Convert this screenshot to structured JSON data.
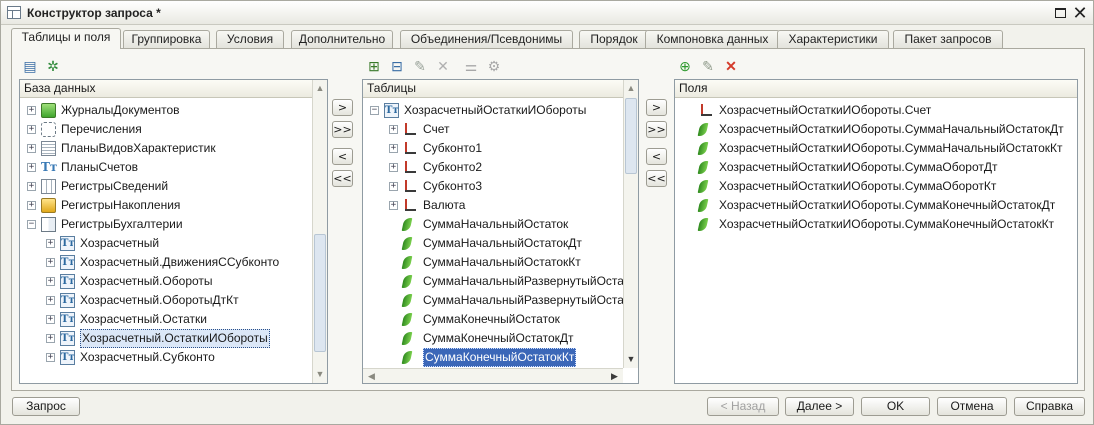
{
  "window": {
    "title": "Конструктор запроса *"
  },
  "tabs": [
    {
      "label": "Таблицы и поля",
      "active": true
    },
    {
      "label": "Группировка"
    },
    {
      "label": "Условия"
    },
    {
      "label": "Дополнительно"
    },
    {
      "label": "Объединения/Псевдонимы"
    },
    {
      "label": "Порядок"
    },
    {
      "label": "Компоновка данных"
    },
    {
      "label": "Характеристики"
    },
    {
      "label": "Пакет запросов"
    }
  ],
  "database_panel": {
    "header": "База данных",
    "items": [
      {
        "label": "ЖурналыДокументов",
        "icon": "journal-icon",
        "expander": "+"
      },
      {
        "label": "Перечисления",
        "icon": "enum-icon",
        "expander": "+"
      },
      {
        "label": "ПланыВидовХарактеристик",
        "icon": "chart-of-char-types-icon",
        "expander": "+"
      },
      {
        "label": "ПланыСчетов",
        "icon": "chart-of-accounts-icon",
        "expander": "+"
      },
      {
        "label": "РегистрыСведений",
        "icon": "info-register-icon",
        "expander": "+"
      },
      {
        "label": "РегистрыНакопления",
        "icon": "accum-register-icon",
        "expander": "+"
      },
      {
        "label": "РегистрыБухгалтерии",
        "icon": "accounting-register-icon",
        "expander": "−"
      },
      {
        "label": "Хозрасчетный",
        "icon": "table-icon",
        "expander": "+",
        "child": true
      },
      {
        "label": "Хозрасчетный.ДвиженияССубконто",
        "icon": "table-icon",
        "expander": "+",
        "child": true
      },
      {
        "label": "Хозрасчетный.Обороты",
        "icon": "table-icon",
        "expander": "+",
        "child": true
      },
      {
        "label": "Хозрасчетный.ОборотыДтКт",
        "icon": "table-icon",
        "expander": "+",
        "child": true
      },
      {
        "label": "Хозрасчетный.Остатки",
        "icon": "table-icon",
        "expander": "+",
        "child": true
      },
      {
        "label": "Хозрасчетный.ОстаткиИОбороты",
        "icon": "table-icon",
        "expander": "+",
        "child": true,
        "selected": true
      },
      {
        "label": "Хозрасчетный.Субконто",
        "icon": "table-icon",
        "expander": "+",
        "child": true
      }
    ]
  },
  "transfer_buttons": {
    "add": ">",
    "add_all": ">>",
    "remove": "<",
    "remove_all": "<<"
  },
  "tables_panel": {
    "header": "Таблицы",
    "items": [
      {
        "label": "ХозрасчетныйОстаткиИОбороты",
        "icon": "table-icon",
        "expander": "−",
        "level": 0
      },
      {
        "label": "Счет",
        "icon": "dimension-icon",
        "expander": "+",
        "level": 1
      },
      {
        "label": "Субконто1",
        "icon": "dimension-icon",
        "expander": "+",
        "level": 1
      },
      {
        "label": "Субконто2",
        "icon": "dimension-icon",
        "expander": "+",
        "level": 1
      },
      {
        "label": "Субконто3",
        "icon": "dimension-icon",
        "expander": "+",
        "level": 1
      },
      {
        "label": "Валюта",
        "icon": "dimension-icon",
        "expander": "+",
        "level": 1
      },
      {
        "label": "СуммаНачальныйОстаток",
        "icon": "resource-icon",
        "level": 1
      },
      {
        "label": "СуммаНачальныйОстатокДт",
        "icon": "resource-icon",
        "level": 1
      },
      {
        "label": "СуммаНачальныйОстатокКт",
        "icon": "resource-icon",
        "level": 1
      },
      {
        "label": "СуммаНачальныйРазвернутыйОстаток",
        "icon": "resource-icon",
        "level": 1
      },
      {
        "label": "СуммаНачальныйРазвернутыйОстаток",
        "icon": "resource-icon",
        "level": 1
      },
      {
        "label": "СуммаКонечныйОстаток",
        "icon": "resource-icon",
        "level": 1
      },
      {
        "label": "СуммаКонечныйОстатокДт",
        "icon": "resource-icon",
        "level": 1
      },
      {
        "label": "СуммаКонечныйОстатокКт",
        "icon": "resource-icon",
        "level": 1,
        "selected": true
      }
    ]
  },
  "fields_panel": {
    "header": "Поля",
    "items": [
      {
        "label": "ХозрасчетныйОстаткиИОбороты.Счет",
        "icon": "dimension-icon"
      },
      {
        "label": "ХозрасчетныйОстаткиИОбороты.СуммаНачальныйОстатокДт",
        "icon": "resource-icon"
      },
      {
        "label": "ХозрасчетныйОстаткиИОбороты.СуммаНачальныйОстатокКт",
        "icon": "resource-icon"
      },
      {
        "label": "ХозрасчетныйОстаткиИОбороты.СуммаОборотДт",
        "icon": "resource-icon"
      },
      {
        "label": "ХозрасчетныйОстаткиИОбороты.СуммаОборотКт",
        "icon": "resource-icon"
      },
      {
        "label": "ХозрасчетныйОстаткиИОбороты.СуммаКонечныйОстатокДт",
        "icon": "resource-icon"
      },
      {
        "label": "ХозрасчетныйОстаткиИОбороты.СуммаКонечныйОстатокКт",
        "icon": "resource-icon"
      }
    ]
  },
  "footer": {
    "query_label": "Запрос",
    "back_label": "< Назад",
    "next_label": "Далее >",
    "ok_label": "OK",
    "cancel_label": "Отмена",
    "help_label": "Справка"
  }
}
